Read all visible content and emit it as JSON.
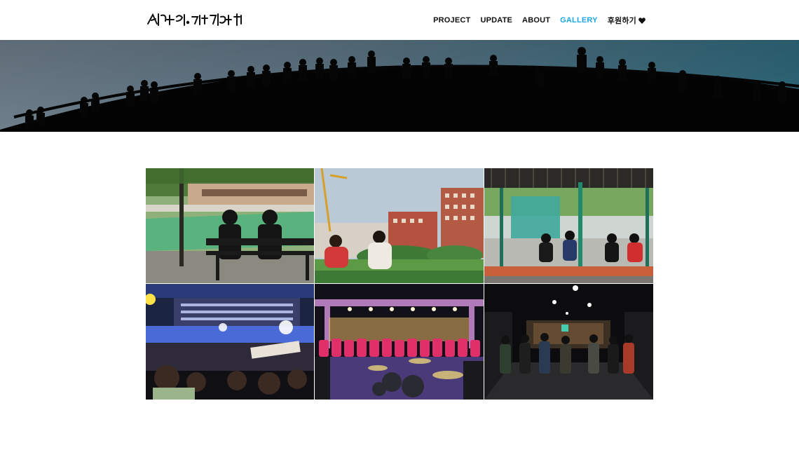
{
  "header": {
    "logo_text": "서가앙니 그리고 기억해",
    "nav": [
      {
        "label": "PROJECT",
        "active": false
      },
      {
        "label": "UPDATE",
        "active": false
      },
      {
        "label": "ABOUT",
        "active": false
      },
      {
        "label": "GALLERY",
        "active": true
      },
      {
        "label": "후원하기",
        "active": false,
        "icon": "heart-icon"
      }
    ],
    "accent_color": "#1ea7e0"
  },
  "hero": {
    "icon": "crowd-silhouette-image"
  },
  "gallery": {
    "items": [
      {
        "scene": "two-people-on-bench-watching-schoolyard"
      },
      {
        "scene": "people-sitting-on-grass-field-school-buildings"
      },
      {
        "scene": "people-sitting-under-pavilion-basketball-court"
      },
      {
        "scene": "gymnasium-performance-crowd-banners"
      },
      {
        "scene": "concert-stage-performers-in-pink-drum-kit"
      },
      {
        "scene": "theater-stage-performers-bowing-audience"
      }
    ]
  }
}
